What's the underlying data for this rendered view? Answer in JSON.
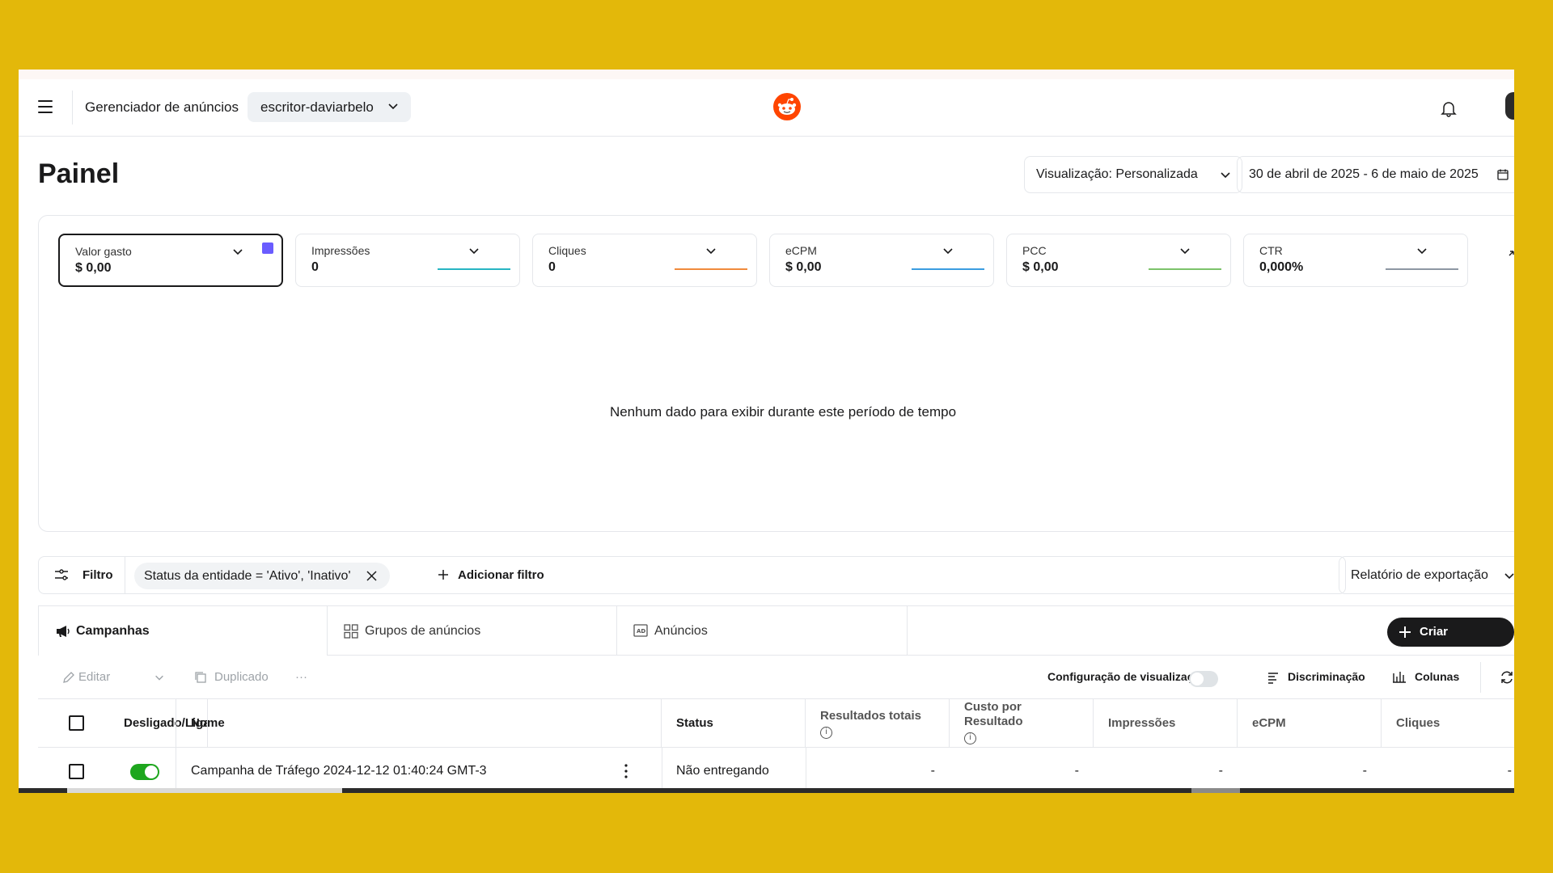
{
  "header": {
    "app_title": "Gerenciador de anúncios",
    "account": "escritor-daviarbelo"
  },
  "page": {
    "title": "Painel",
    "view_select": "Visualização: Personalizada",
    "date_range": "30 de abril de 2025 - 6 de maio de 2025"
  },
  "metrics": [
    {
      "label": "Valor gasto",
      "value": "$ 0,00",
      "color": "#6a5cff"
    },
    {
      "label": "Impressões",
      "value": "0",
      "color": "#27b5c3"
    },
    {
      "label": "Cliques",
      "value": "0",
      "color": "#f08a3c"
    },
    {
      "label": "eCPM",
      "value": "$ 0,00",
      "color": "#3b9de0"
    },
    {
      "label": "PCC",
      "value": "$ 0,00",
      "color": "#7cc36a"
    },
    {
      "label": "CTR",
      "value": "0,000%",
      "color": "#8d97a3"
    }
  ],
  "empty_message": "Nenhum dado para exibir durante este período de tempo",
  "filters": {
    "filter_label": "Filtro",
    "chip": "Status da entidade = 'Ativo', 'Inativo'",
    "add_filter": "Adicionar filtro",
    "export": "Relatório de exportação"
  },
  "tabs": [
    {
      "label": "Campanhas",
      "active": true
    },
    {
      "label": "Grupos de anúncios",
      "active": false
    },
    {
      "label": "Anúncios",
      "active": false
    }
  ],
  "create_button": "Criar campanha",
  "toolbar": {
    "edit": "Editar",
    "duplicate": "Duplicado",
    "more": "···",
    "view_config": "Configuração de visualização",
    "breakdown": "Discriminação",
    "columns": "Colunas"
  },
  "table": {
    "columns": {
      "onoff": "Desligado/Ligado",
      "name": "Nome",
      "status": "Status",
      "results": "Resultados totais",
      "cost_per_result": "Custo por Resultado",
      "impressions": "Impressões",
      "ecpm": "eCPM",
      "clicks": "Cliques"
    },
    "rows": [
      {
        "name": "Campanha de Tráfego 2024-12-12 01:40:24 GMT-3",
        "status": "Não entregando",
        "results": "-",
        "cost_per_result": "-",
        "impressions": "-",
        "ecpm": "-",
        "clicks": "-"
      }
    ]
  }
}
